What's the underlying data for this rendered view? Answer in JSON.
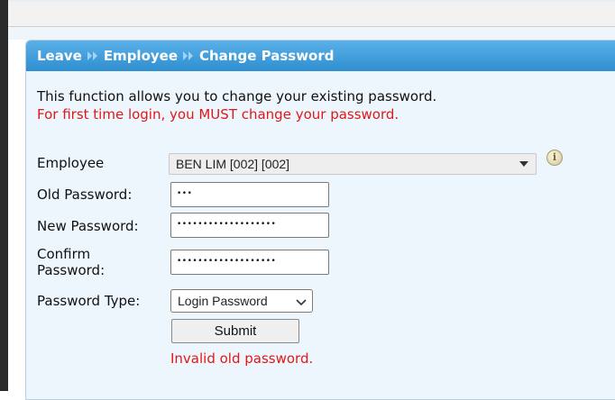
{
  "header": {
    "crumbs": [
      "Leave",
      "Employee",
      "Change Password"
    ]
  },
  "intro": {
    "line1": "This function allows you to change your existing password.",
    "line2": "For first time login, you MUST change your password."
  },
  "form": {
    "employee_label": "Employee",
    "employee_value": "BEN LIM [002] [002]",
    "old_password_label": "Old Password:",
    "old_password_mask": "•••",
    "new_password_label": "New Password:",
    "new_password_mask": "•••••••••••••••••••",
    "confirm_label_line1": "Confirm",
    "confirm_label_line2": "Password:",
    "confirm_password_mask": "•••••••••••••••••••",
    "password_type_label": "Password Type:",
    "password_type_value": "Login Password",
    "submit_label": "Submit",
    "error_message": "Invalid old password."
  },
  "icons": {
    "info": "info-icon",
    "breadcrumb_separator": "double-chevron-right-icon"
  },
  "colors": {
    "header_blue": "#3b9ad9",
    "error_red": "#e01818",
    "panel_bg": "#edf6fd"
  }
}
